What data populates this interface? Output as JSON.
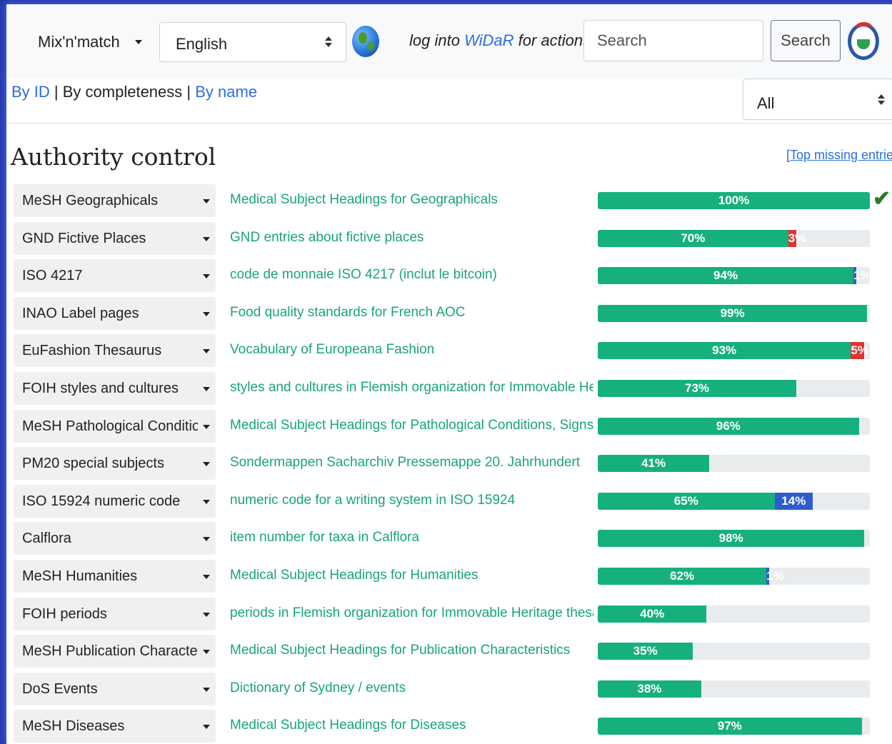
{
  "nav": {
    "brand": "Mix'n'match",
    "language": "English",
    "login_prefix": "log into ",
    "login_link": "WiDaR",
    "login_suffix": " for actions",
    "search_placeholder": "Search",
    "search_button": "Search"
  },
  "sort": {
    "by_id": "By ID",
    "sep": " | ",
    "by_completeness": "By completeness",
    "by_name": "By name"
  },
  "filter": {
    "selected": "All"
  },
  "section": {
    "title": "Authority control",
    "top_missing": "[Top missing entries]"
  },
  "colors": {
    "background_accent": "#2436a8",
    "progress_green": "#16b07f",
    "progress_blue": "#2d5ccf",
    "progress_red": "#e2322f",
    "link_blue": "#2a6fdb",
    "description_green": "#19a47a"
  },
  "catalogs": [
    {
      "name": "MeSH Geographicals",
      "description": "Medical Subject Headings for Geographicals",
      "green": 100,
      "green_label": "100%",
      "blue": 0,
      "blue_label": "",
      "red": 0,
      "red_label": "",
      "complete": true
    },
    {
      "name": "GND Fictive Places",
      "description": "GND entries about fictive places",
      "green": 70,
      "green_label": "70%",
      "blue": 0,
      "blue_label": "",
      "red": 3,
      "red_label": "3%",
      "complete": false
    },
    {
      "name": "ISO 4217",
      "description": "code de monnaie ISO 4217 (inclut le bitcoin)",
      "green": 94,
      "green_label": "94%",
      "blue": 1,
      "blue_label": "1%",
      "red": 0,
      "red_label": "",
      "complete": false
    },
    {
      "name": "INAO Label pages",
      "description": "Food quality standards for French AOC",
      "green": 99,
      "green_label": "99%",
      "blue": 0,
      "blue_label": "",
      "red": 0,
      "red_label": "",
      "complete": false
    },
    {
      "name": "EuFashion Thesaurus",
      "description": "Vocabulary of Europeana Fashion",
      "green": 93,
      "green_label": "93%",
      "blue": 0,
      "blue_label": "",
      "red": 5,
      "red_label": "5%",
      "complete": false
    },
    {
      "name": "FOIH styles and cultures",
      "description": "styles and cultures in Flemish organization for Immovable Heritage thesauri",
      "green": 73,
      "green_label": "73%",
      "blue": 0,
      "blue_label": "",
      "red": 0,
      "red_label": "",
      "complete": false
    },
    {
      "name": "MeSH Pathological Conditions",
      "description": "Medical Subject Headings for Pathological Conditions, Signs and Symptoms",
      "green": 96,
      "green_label": "96%",
      "blue": 0,
      "blue_label": "",
      "red": 0,
      "red_label": "",
      "complete": false
    },
    {
      "name": "PM20 special subjects",
      "description": "Sondermappen Sacharchiv Pressemappe 20. Jahrhundert",
      "green": 41,
      "green_label": "41%",
      "blue": 0,
      "blue_label": "",
      "red": 0,
      "red_label": "",
      "complete": false
    },
    {
      "name": "ISO 15924 numeric code",
      "description": "numeric code for a writing system in ISO 15924",
      "green": 65,
      "green_label": "65%",
      "blue": 14,
      "blue_label": "14%",
      "red": 0,
      "red_label": "",
      "complete": false
    },
    {
      "name": "Calflora",
      "description": "item number for taxa in Calflora",
      "green": 98,
      "green_label": "98%",
      "blue": 0,
      "blue_label": "",
      "red": 0,
      "red_label": "",
      "complete": false
    },
    {
      "name": "MeSH Humanities",
      "description": "Medical Subject Headings for Humanities",
      "green": 62,
      "green_label": "62%",
      "blue": 1,
      "blue_label": "1%",
      "red": 0,
      "red_label": "",
      "complete": false
    },
    {
      "name": "FOIH periods",
      "description": "periods in Flemish organization for Immovable Heritage thesauri",
      "green": 40,
      "green_label": "40%",
      "blue": 0,
      "blue_label": "",
      "red": 0,
      "red_label": "",
      "complete": false
    },
    {
      "name": "MeSH Publication Characteristics",
      "description": "Medical Subject Headings for Publication Characteristics",
      "green": 35,
      "green_label": "35%",
      "blue": 0,
      "blue_label": "",
      "red": 0,
      "red_label": "",
      "complete": false
    },
    {
      "name": "DoS Events",
      "description": "Dictionary of Sydney / events",
      "green": 38,
      "green_label": "38%",
      "blue": 0,
      "blue_label": "",
      "red": 0,
      "red_label": "",
      "complete": false
    },
    {
      "name": "MeSH Diseases",
      "description": "Medical Subject Headings for Diseases",
      "green": 97,
      "green_label": "97%",
      "blue": 0,
      "blue_label": "",
      "red": 0,
      "red_label": "",
      "complete": false
    }
  ]
}
